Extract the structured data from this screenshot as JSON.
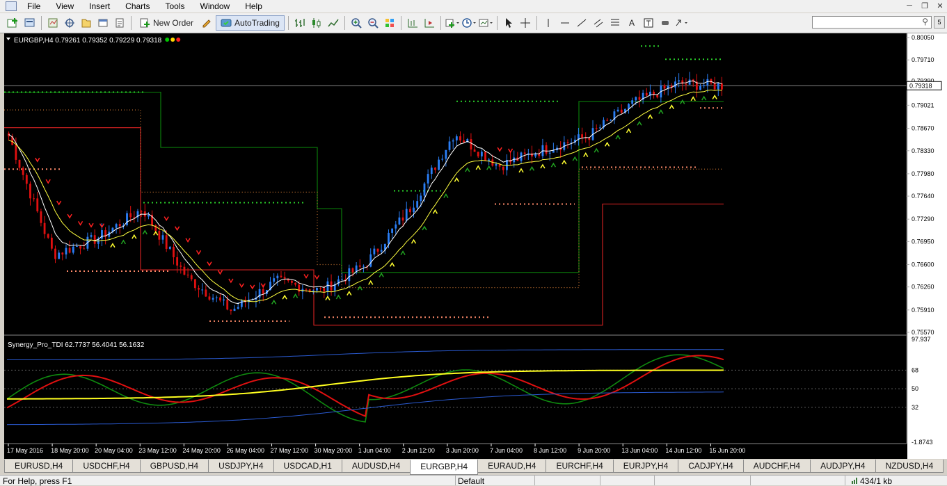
{
  "menu": [
    "File",
    "View",
    "Insert",
    "Charts",
    "Tools",
    "Window",
    "Help"
  ],
  "toolbar": {
    "new_order": "New Order",
    "auto_trading": "AutoTrading"
  },
  "chart": {
    "title": "EURGBP,H4  0.79261 0.79352 0.79229 0.79318",
    "current_price": "0.79318",
    "price_labels": [
      "0.80050",
      "0.79710",
      "0.79390",
      "0.79021",
      "0.78670",
      "0.78330",
      "0.77980",
      "0.77640",
      "0.77290",
      "0.76950",
      "0.76600",
      "0.76260",
      "0.75910",
      "0.75570"
    ],
    "time_labels": [
      "17 May 2016",
      "18 May 20:00",
      "20 May 04:00",
      "23 May 12:00",
      "24 May 20:00",
      "26 May 04:00",
      "27 May 12:00",
      "30 May 20:00",
      "1 Jun 04:00",
      "2 Jun 12:00",
      "3 Jun 20:00",
      "7 Jun 04:00",
      "8 Jun 12:00",
      "9 Jun 20:00",
      "13 Jun 04:00",
      "14 Jun 12:00",
      "15 Jun 20:00"
    ],
    "status_dot_colors": [
      "#00c800",
      "#ffd700",
      "#ff2020"
    ],
    "up_color": "#2a7ef5",
    "down_color": "#e01010"
  },
  "indicator": {
    "title": "Synergy_Pro_TDI 62.7737 56.4041 56.1632",
    "levels": [
      "97.937",
      "68",
      "50",
      "32",
      "-1.8743"
    ]
  },
  "chart_data": {
    "type": "line",
    "title": "EURGBP,H4  0.79261 0.79352 0.79229 0.79318",
    "xlabel": "",
    "ylabel": "",
    "ylim": [
      0.7557,
      0.8005
    ],
    "categories": [
      "17 May 2016",
      "18 May 20:00",
      "20 May 04:00",
      "23 May 12:00",
      "24 May 20:00",
      "26 May 04:00",
      "27 May 12:00",
      "30 May 20:00",
      "1 Jun 04:00",
      "2 Jun 12:00",
      "3 Jun 20:00",
      "7 Jun 04:00",
      "8 Jun 12:00",
      "9 Jun 20:00",
      "13 Jun 04:00",
      "14 Jun 12:00",
      "15 Jun 20:00"
    ],
    "series": [
      {
        "name": "EURGBP,H4",
        "values": [
          0.7855,
          0.7675,
          0.77,
          0.7745,
          0.764,
          0.759,
          0.7635,
          0.762,
          0.766,
          0.7745,
          0.786,
          0.781,
          0.7835,
          0.7855,
          0.7905,
          0.7935,
          0.7932
        ]
      }
    ]
  },
  "tabs": [
    "EURUSD,H4",
    "USDCHF,H4",
    "GBPUSD,H4",
    "USDJPY,H4",
    "USDCAD,H1",
    "AUDUSD,H4",
    "EURGBP,H4",
    "EURAUD,H4",
    "EURCHF,H4",
    "EURJPY,H4",
    "CADJPY,H4",
    "AUDCHF,H4",
    "AUDJPY,H4",
    "NZDUSD,H4"
  ],
  "active_tab": "EURGBP,H4",
  "status": {
    "help": "For Help, press F1",
    "profile": "Default",
    "traffic": "434/1 kb"
  }
}
